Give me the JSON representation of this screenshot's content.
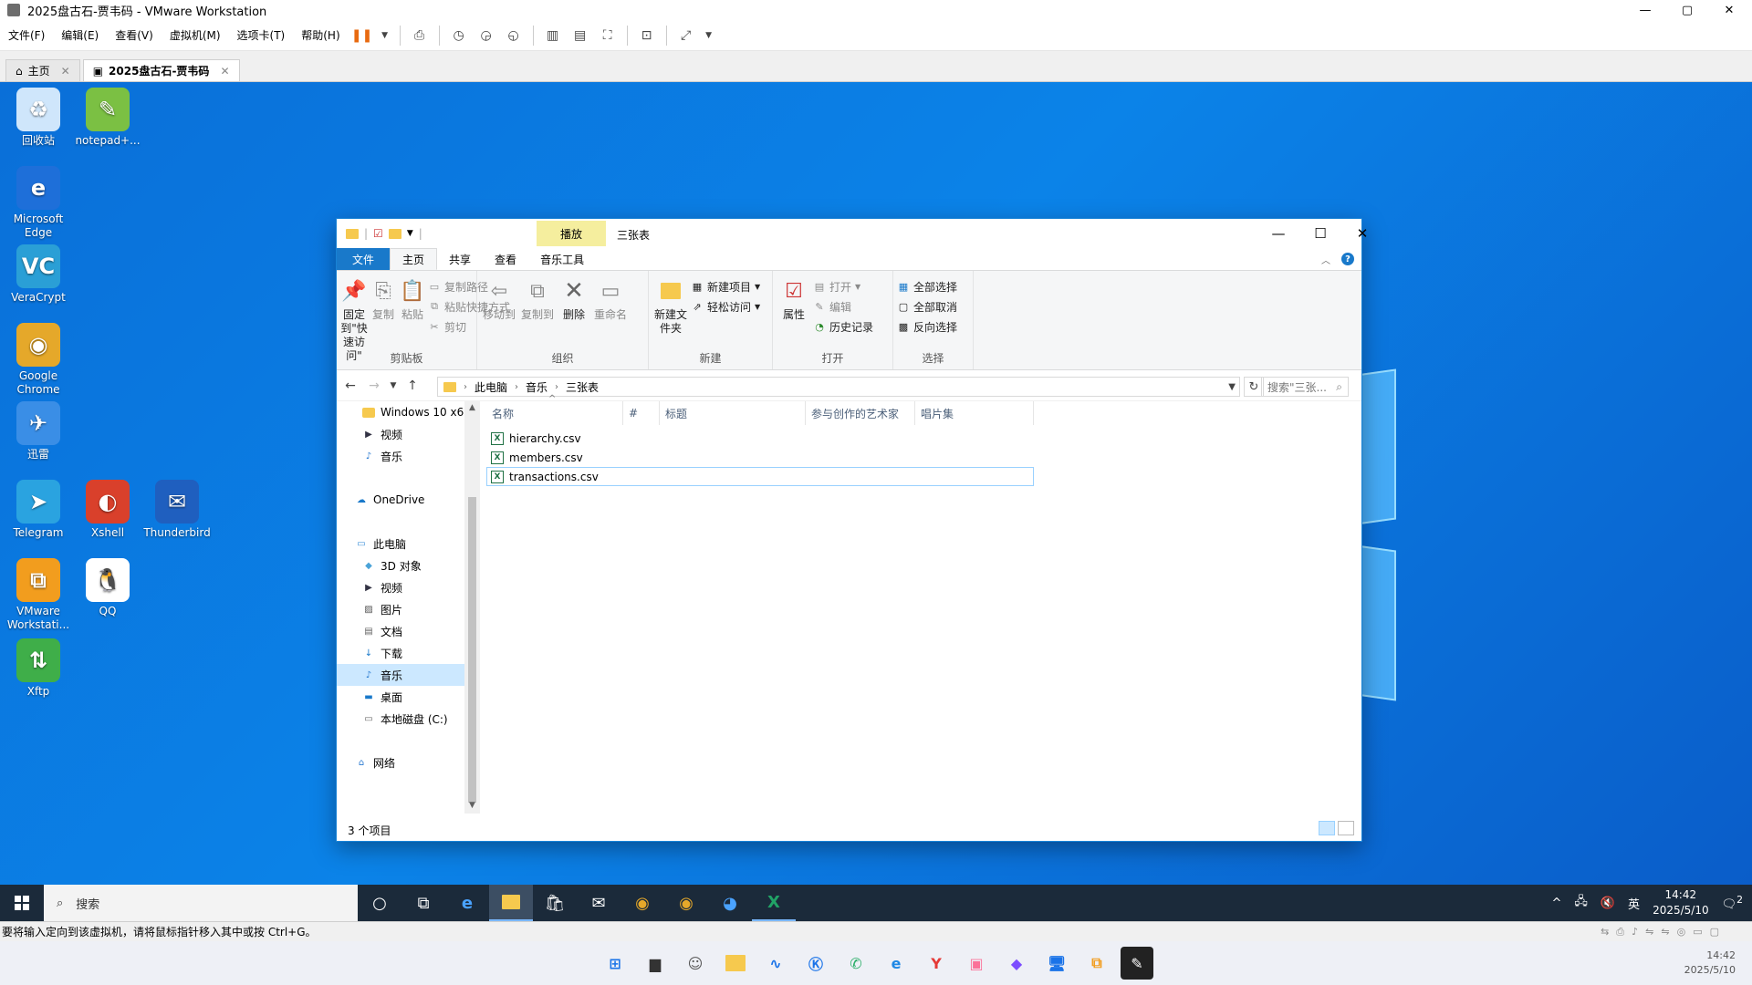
{
  "vm": {
    "title": "2025盘古石-贾韦码 - VMware Workstation",
    "menus": [
      "文件(F)",
      "编辑(E)",
      "查看(V)",
      "虚拟机(M)",
      "选项卡(T)",
      "帮助(H)"
    ],
    "tabs": [
      {
        "label": "主页"
      },
      {
        "label": "2025盘古石-贾韦码"
      }
    ],
    "status_text": "要将输入定向到该虚拟机，请将鼠标指针移入其中或按 Ctrl+G。"
  },
  "desktop": {
    "icons": [
      {
        "label": "回收站",
        "icon": "recycle-bin-icon",
        "color": "#cfe6fb"
      },
      {
        "label": "notepad+...",
        "icon": "notepad-plus-icon",
        "color": "#7bc043"
      },
      {
        "label": "Microsoft Edge",
        "icon": "edge-icon",
        "color": "#1e6fd9"
      },
      {
        "label": "VeraCrypt",
        "icon": "veracrypt-icon",
        "color": "#2a9fd6"
      },
      {
        "label": "Google Chrome",
        "icon": "chrome-icon",
        "color": "#e5a82a"
      },
      {
        "label": "迅雷",
        "icon": "xunlei-icon",
        "color": "#3a8ee6"
      },
      {
        "label": "Telegram",
        "icon": "telegram-icon",
        "color": "#2aa3e0"
      },
      {
        "label": "Xshell",
        "icon": "xshell-icon",
        "color": "#d9402b"
      },
      {
        "label": "Thunderbird",
        "icon": "thunderbird-icon",
        "color": "#1f5fbf"
      },
      {
        "label": "VMware Workstati...",
        "icon": "vmware-icon",
        "color": "#f29d1e"
      },
      {
        "label": "QQ",
        "icon": "qq-icon",
        "color": "#ffffff"
      },
      {
        "label": "Xftp",
        "icon": "xftp-icon",
        "color": "#3fae49"
      }
    ]
  },
  "explorer": {
    "title": "三张表",
    "context_tab": "播放",
    "ribbon_tabs": [
      "文件",
      "主页",
      "共享",
      "查看",
      "音乐工具"
    ],
    "groups": {
      "clipboard": {
        "name": "剪贴板",
        "pin": "固定到\"快速访问\"",
        "copy": "复制",
        "paste": "粘贴",
        "copy_path": "复制路径",
        "paste_shortcut": "粘贴快捷方式",
        "cut": "剪切"
      },
      "organize": {
        "name": "组织",
        "move_to": "移动到",
        "copy_to": "复制到",
        "delete": "删除",
        "rename": "重命名"
      },
      "new": {
        "name": "新建",
        "new_folder": "新建文件夹",
        "new_item": "新建项目",
        "easy_access": "轻松访问"
      },
      "open": {
        "name": "打开",
        "properties": "属性",
        "open": "打开",
        "edit": "编辑",
        "history": "历史记录"
      },
      "select": {
        "name": "选择",
        "select_all": "全部选择",
        "select_none": "全部取消",
        "invert": "反向选择"
      }
    },
    "breadcrumb": [
      "此电脑",
      "音乐",
      "三张表"
    ],
    "search_placeholder": "搜索\"三张...",
    "nav_items": [
      {
        "label": "Windows 10 x6",
        "icon": "folder-icon",
        "indent": 1
      },
      {
        "label": "视频",
        "icon": "video-icon",
        "indent": 1
      },
      {
        "label": "音乐",
        "icon": "music-icon",
        "indent": 1
      },
      {
        "label": "",
        "icon": "",
        "indent": 0
      },
      {
        "label": "OneDrive",
        "icon": "onedrive-icon",
        "indent": 0
      },
      {
        "label": "",
        "icon": "",
        "indent": 0
      },
      {
        "label": "此电脑",
        "icon": "pc-icon",
        "indent": 0
      },
      {
        "label": "3D 对象",
        "icon": "3d-icon",
        "indent": 1
      },
      {
        "label": "视频",
        "icon": "video-icon",
        "indent": 1
      },
      {
        "label": "图片",
        "icon": "pictures-icon",
        "indent": 1
      },
      {
        "label": "文档",
        "icon": "documents-icon",
        "indent": 1
      },
      {
        "label": "下载",
        "icon": "download-icon",
        "indent": 1
      },
      {
        "label": "音乐",
        "icon": "music-icon",
        "indent": 1,
        "selected": true
      },
      {
        "label": "桌面",
        "icon": "desktop-icon",
        "indent": 1
      },
      {
        "label": "本地磁盘 (C:)",
        "icon": "drive-icon",
        "indent": 1
      },
      {
        "label": "",
        "icon": "",
        "indent": 0
      },
      {
        "label": "网络",
        "icon": "network-icon",
        "indent": 0
      }
    ],
    "columns": [
      "名称",
      "#",
      "标题",
      "参与创作的艺术家",
      "唱片集"
    ],
    "files": [
      {
        "name": "hierarchy.csv"
      },
      {
        "name": "members.csv"
      },
      {
        "name": "transactions.csv",
        "focused": true
      }
    ],
    "status": "3 个项目"
  },
  "taskbar": {
    "search_label": "搜索",
    "ime": "英",
    "time": "14:42",
    "date": "2025/5/10",
    "notif_count": "2"
  },
  "host": {
    "time": "14:42",
    "date": "2025/5/10"
  }
}
